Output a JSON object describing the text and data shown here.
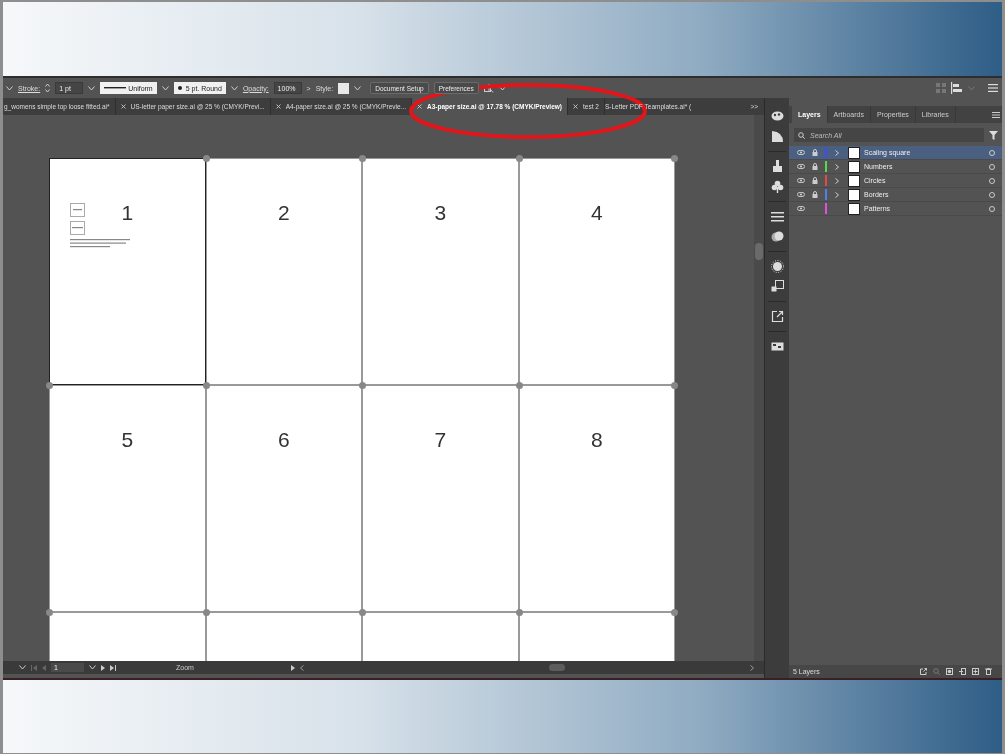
{
  "control_bar": {
    "stroke_label": "Stroke:",
    "stroke_weight": "1 pt",
    "stroke_profile": "Uniform",
    "brush": "5 pt. Round",
    "opacity_label": "Opacity:",
    "opacity": "100%",
    "opacity_arrow": ">",
    "style_label": "Style:",
    "buttons": [
      "Document Setup",
      "Preferences"
    ]
  },
  "document_tabs": [
    {
      "label": "g_womens simple top loose fitted.ai*",
      "closable": false,
      "selected": false
    },
    {
      "label": "US-letter paper size.ai @ 25 % (CMYK/Previ...",
      "closable": true,
      "selected": false
    },
    {
      "label": "A4-paper size.ai @ 25 % (CMYK/Previe...",
      "closable": true,
      "selected": false
    },
    {
      "label": "A3-paper size.ai @ 17.78 % (CMYK/Preview)",
      "closable": true,
      "selected": true
    },
    {
      "label": "test 2",
      "closable": true,
      "selected": false
    },
    {
      "label": "S-Letter PDF Teamplates.ai* (",
      "closable": false,
      "selected": false
    }
  ],
  "tabs_overflow": ">>",
  "artboards": [
    {
      "number": "1",
      "kind": "guide",
      "selected": true
    },
    {
      "number": "2",
      "kind": "blank",
      "selected": false
    },
    {
      "number": "3",
      "kind": "blank",
      "selected": false
    },
    {
      "number": "4",
      "kind": "blank",
      "selected": false
    },
    {
      "number": "5",
      "kind": "blank",
      "selected": false
    },
    {
      "number": "6",
      "kind": "blank",
      "selected": false
    },
    {
      "number": "7",
      "kind": "blank",
      "selected": false
    },
    {
      "number": "8",
      "kind": "blank",
      "selected": false
    }
  ],
  "layers_panel": {
    "tabs": [
      {
        "label": "Layers",
        "selected": true
      },
      {
        "label": "Artboards",
        "selected": false
      },
      {
        "label": "Properties",
        "selected": false
      },
      {
        "label": "Libraries",
        "selected": false
      }
    ],
    "search": {
      "placeholder": "Search All"
    },
    "layers": [
      {
        "name": "Scaling square",
        "color": "#4848f0",
        "locked": true,
        "expandable": true,
        "selected": true
      },
      {
        "name": "Numbers",
        "color": "#4fdc4f",
        "locked": true,
        "expandable": true,
        "selected": false
      },
      {
        "name": "Circles",
        "color": "#e84848",
        "locked": true,
        "expandable": true,
        "selected": false
      },
      {
        "name": "Borders",
        "color": "#4f7ff0",
        "locked": true,
        "expandable": true,
        "selected": false
      },
      {
        "name": "Patterns",
        "color": "#e04fe0",
        "locked": false,
        "expandable": false,
        "selected": false
      }
    ],
    "count": "5 Layers"
  },
  "status_bar": {
    "artboard": "1",
    "zoom_label": "Zoom"
  }
}
